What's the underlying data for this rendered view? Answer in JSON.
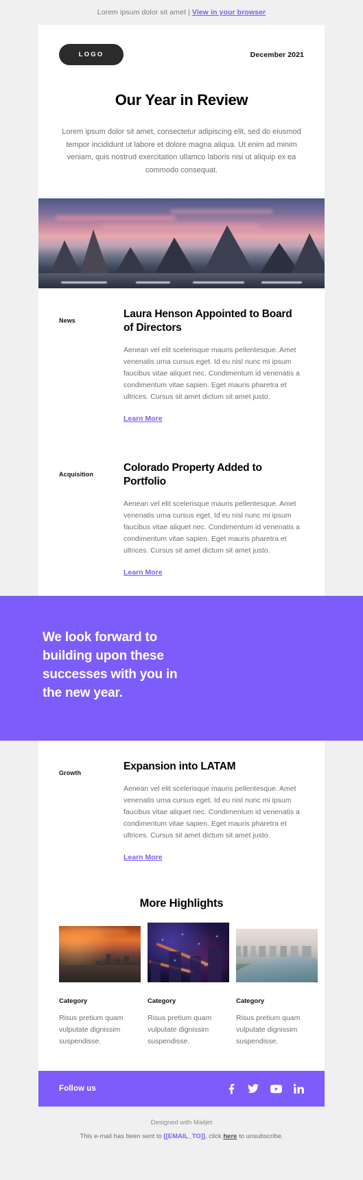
{
  "preheader": {
    "text": "Lorem ipsum dolor sit amet",
    "separator": "|",
    "link_label": "View in your browser"
  },
  "header": {
    "logo_label": "LOGO",
    "issue_date": "December 2021"
  },
  "intro": {
    "title": "Our Year in Review",
    "body": "Lorem ipsum dolor sit amet, consectetur adipiscing elit, sed do eiusmod tempor incididunt ut labore et dolore magna aliqua. Ut enim ad minim veniam, quis nostrud exercitation ullamco laboris nisi ut aliquip ex ea commodo consequat."
  },
  "hero_image": {
    "alt": "mountain-sunset-photo"
  },
  "articles": [
    {
      "label": "News",
      "title": "Laura Henson Appointed to Board of Directors",
      "text": "Aenean vel elit scelerisque mauris pellentesque. Amet venenatis urna cursus eget. Id eu nisl nunc mi ipsum faucibus vitae aliquet nec. Condimentum id venenatis a condimentum vitae sapien. Eget mauris pharetra et ultrices. Cursus sit amet dictum sit amet justo.",
      "link_label": "Learn More"
    },
    {
      "label": "Acquisition",
      "title": "Colorado Property Added to Portfolio",
      "text": "Aenean vel elit scelerisque mauris pellentesque. Amet venenatis urna cursus eget. Id eu nisl nunc mi ipsum faucibus vitae aliquet nec. Condimentum id venenatis a condimentum vitae sapien. Eget mauris pharetra et ultrices. Cursus sit amet dictum sit amet justo.",
      "link_label": "Learn More"
    }
  ],
  "quote_banner": {
    "text": "We look forward to building upon these successes with you in the new year.",
    "background": "#7C5CFA"
  },
  "growth_article": {
    "label": "Growth",
    "title": "Expansion into LATAM",
    "text": "Aenean vel elit scelerisque mauris pellentesque. Amet venenatis urna cursus eget. Id eu nisl nunc mi ipsum faucibus vitae aliquet nec. Condimentum id venenatis a condimentum vitae sapien. Eget mauris pharetra et ultrices. Cursus sit amet dictum sit amet justo.",
    "link_label": "Learn More"
  },
  "highlights": {
    "title": "More Highlights",
    "cards": [
      {
        "image_alt": "city-skyline-sunset-photo",
        "category": "Category",
        "description": "Risus pretium quam vulputate dignissim suspendisse."
      },
      {
        "image_alt": "neon-city-night-photo",
        "category": "Category",
        "description": "Risus pretium quam vulputate dignissim suspendisse."
      },
      {
        "image_alt": "aerial-river-city-photo",
        "category": "Category",
        "description": "Risus pretium quam vulputate dignissim suspendisse."
      }
    ]
  },
  "follow": {
    "label": "Follow us",
    "background": "#7C5CFA",
    "socials": [
      {
        "name": "facebook-icon"
      },
      {
        "name": "twitter-icon"
      },
      {
        "name": "youtube-icon"
      },
      {
        "name": "linkedin-icon"
      }
    ]
  },
  "footer": {
    "designed_by": "Designed with Mailjet",
    "legal_prefix": "This e-mail has been sent to ",
    "email_token": "[[EMAIL_TO]]",
    "legal_mid": ", click ",
    "unsubscribe_label": "here",
    "legal_suffix": " to unsubscribe."
  },
  "colors": {
    "accent": "#7C5CFA",
    "page_background": "#F0F0F0",
    "card_background": "#FFFFFF",
    "body_text": "#6E6E6E",
    "heading_text": "#000000",
    "logo_pill": "#2B2B2B"
  }
}
